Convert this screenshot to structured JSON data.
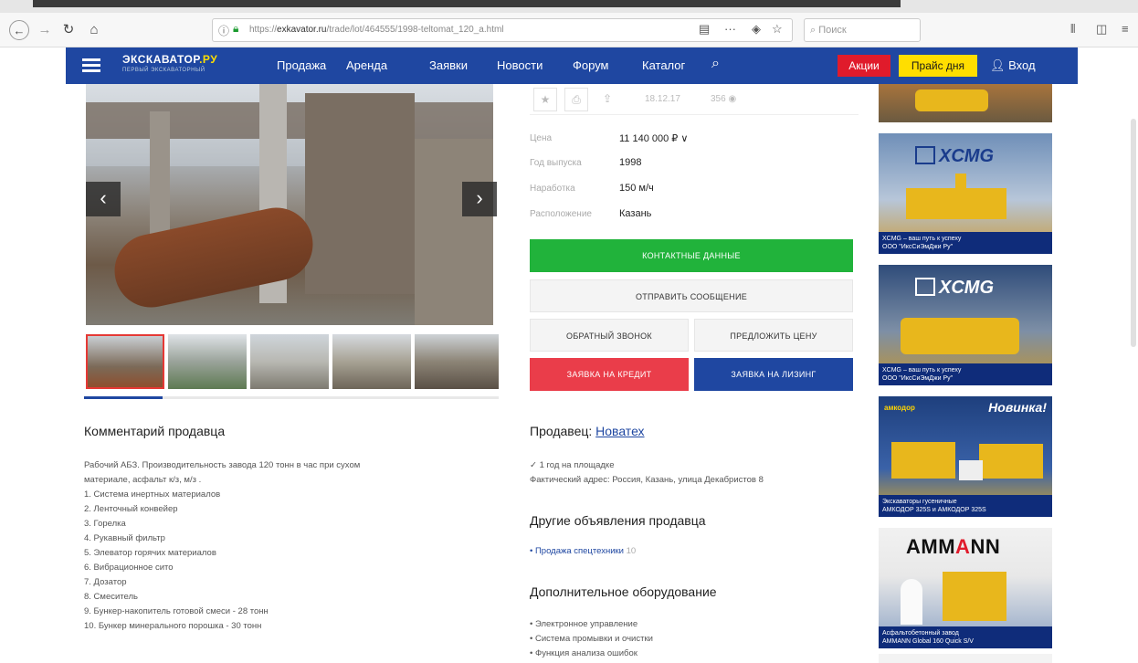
{
  "browser": {
    "url_prefix": "https://",
    "url_domain": "exkavator.ru",
    "url_path": "/trade/lot/464555/1998-teltomat_120_a.html",
    "search_placeholder": "Поиск"
  },
  "site": {
    "logo_main": "ЭКСКАВАТОР",
    "logo_ru": ".РУ",
    "logo_sub": "ПЕРВЫЙ ЭКСКАВАТОРНЫЙ",
    "nav": [
      "Продажа",
      "Аренда",
      "Заявки",
      "Новости",
      "Форум",
      "Каталог"
    ],
    "akcii": "Акции",
    "price_day": "Прайс дня",
    "login": "Вход"
  },
  "listing": {
    "date": "18.12.17",
    "views": "356",
    "props": [
      {
        "label": "Цена",
        "value": "11 140 000 ₽ ∨"
      },
      {
        "label": "Год выпуска",
        "value": "1998"
      },
      {
        "label": "Наработка",
        "value": "150 м/ч"
      },
      {
        "label": "Расположение",
        "value": "Казань"
      }
    ],
    "buttons": {
      "contacts": "КОНТАКТНЫЕ ДАННЫЕ",
      "send_message": "ОТПРАВИТЬ СООБЩЕНИЕ",
      "callback": "ОБРАТНЫЙ ЗВОНОК",
      "offer_price": "ПРЕДЛОЖИТЬ ЦЕНУ",
      "credit": "ЗАЯВКА НА КРЕДИТ",
      "leasing": "ЗАЯВКА НА ЛИЗИНГ"
    }
  },
  "comment": {
    "heading": "Комментарий продавца",
    "lines": [
      "Рабочий АБЗ. Производительность завода 120 тонн в час при сухом",
      "материале, асфальт к/з, м/з .",
      "1. Система инертных материалов",
      "2. Ленточный конвейер",
      "3. Горелка",
      "4. Рукавный фильтр",
      "5. Элеватор горячих материалов",
      "6. Вибрационное сито",
      "7. Дозатор",
      "8. Смеситель",
      "9. Бункер-накопитель готовой смеси - 28 тонн",
      "10. Бункер минерального порошка - 30 тонн"
    ]
  },
  "seller": {
    "label": "Продавец:",
    "name": "Новатех",
    "lines": [
      "✓ 1 год на площадке",
      "Фактический адрес: Россия, Казань, улица Декабристов 8"
    ],
    "other_heading": "Другие объявления продавца",
    "other_link": "Продажа спецтехники",
    "other_count": "10",
    "equip_heading": "Дополнительное оборудование",
    "equip": [
      "• Электронное управление",
      "• Система промывки и очистки",
      "• Функция анализа ошибок"
    ]
  },
  "ads": {
    "xcmg_logo": "XCMG",
    "xcmg1_caption_1": "XCMG – ваш путь к успеху",
    "xcmg1_caption_2": "ООО \"ИксСиЭмДжи Ру\"",
    "xcmg2_caption_1": "XCMG – ваш путь к успеху",
    "xcmg2_caption_2": "ООО \"ИксСиЭмДжи Ру\"",
    "amkodor_brand": "амкодор",
    "amkodor_new": "Новинка!",
    "amkodor_caption_1": "Экскаваторы гусеничные",
    "amkodor_caption_2": "АМКОДОР 325S и АМКОДОР 325S",
    "ammann_logo_a": "AMM",
    "ammann_logo_b": "A",
    "ammann_logo_c": "NN",
    "ammann_caption_1": "Асфальтобетонный завод",
    "ammann_caption_2": "AMMANN Global 160 Quick S/V"
  }
}
